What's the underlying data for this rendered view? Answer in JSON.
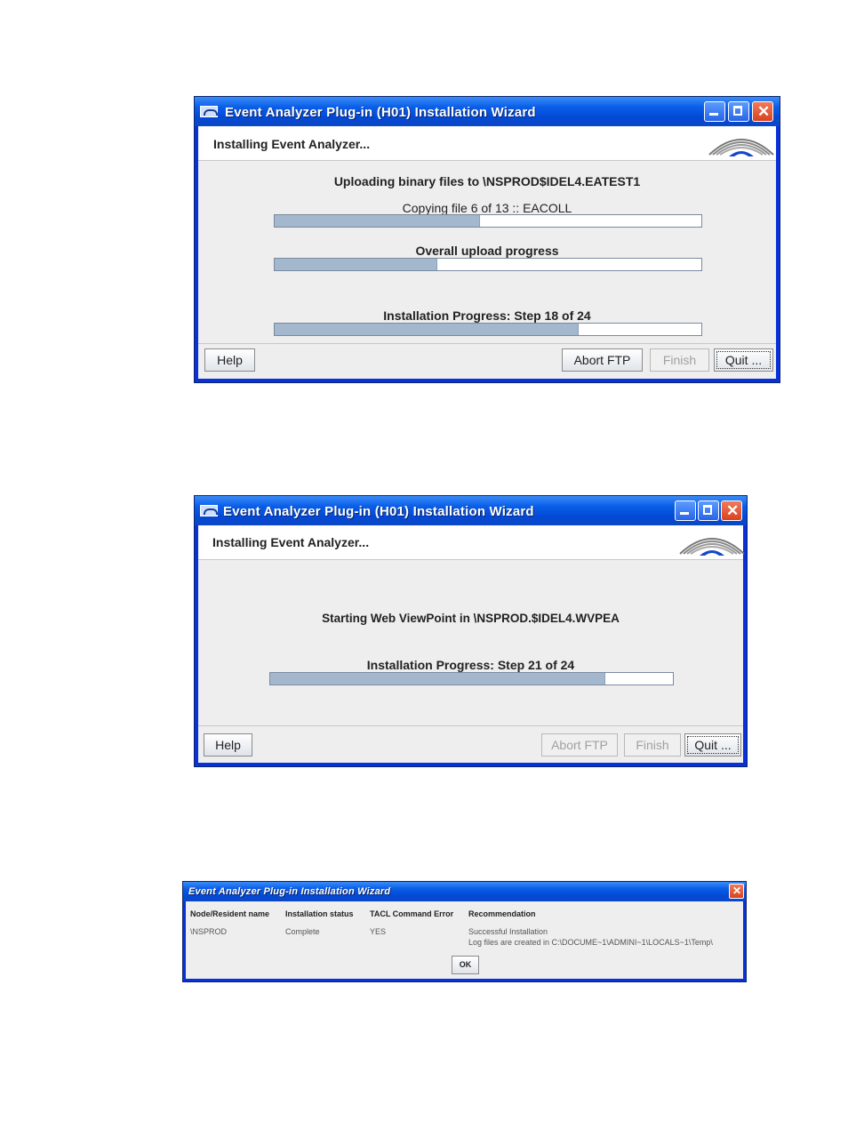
{
  "dialog1": {
    "title": "Event Analyzer Plug-in (H01) Installation Wizard",
    "header": "Installing Event Analyzer...",
    "upload_message": "Uploading binary files to \\NSPROD$IDEL4.EATEST1",
    "file_message": "Copying file 6 of 13 ::  EACOLL",
    "file_progress": 0.48,
    "overall_label": "Overall upload progress",
    "overall_progress": 0.38,
    "install_label": "Installation Progress: Step 18 of 24",
    "install_progress": 0.71,
    "buttons": {
      "help": "Help",
      "abort": "Abort FTP",
      "finish": "Finish",
      "quit": "Quit ..."
    }
  },
  "dialog2": {
    "title": "Event Analyzer Plug-in (H01) Installation Wizard",
    "header": "Installing Event Analyzer...",
    "start_message": "Starting Web ViewPoint in \\NSPROD.$IDEL4.WVPEA",
    "install_label": "Installation Progress: Step 21 of 24",
    "install_progress": 0.83,
    "buttons": {
      "help": "Help",
      "abort": "Abort FTP",
      "finish": "Finish",
      "quit": "Quit ..."
    }
  },
  "dialog3": {
    "title": "Event Analyzer Plug-in Installation Wizard",
    "columns": [
      "Node/Resident name",
      "Installation status",
      "TACL Command Error",
      "Recommendation"
    ],
    "row": {
      "node": "\\NSPROD",
      "status": "Complete",
      "error": "YES",
      "recommendation_line1": "Successful Installation",
      "recommendation_line2": "Log files are created in C:\\DOCUME~1\\ADMINI~1\\LOCALS~1\\Temp\\"
    },
    "ok_label": "OK"
  },
  "icons": [
    "app-icon",
    "minimize-icon",
    "maximize-icon",
    "close-icon",
    "product-logo-icon"
  ]
}
